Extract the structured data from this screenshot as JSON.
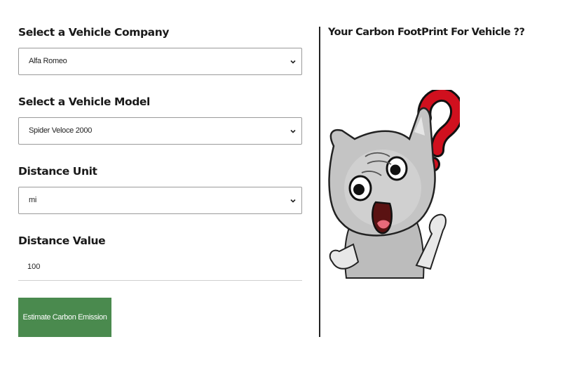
{
  "form": {
    "company": {
      "label": "Select a Vehicle Company",
      "value": "Alfa Romeo"
    },
    "model": {
      "label": "Select a Vehicle Model",
      "value": "Spider Veloce 2000"
    },
    "unit": {
      "label": "Distance Unit",
      "value": "mi"
    },
    "distance": {
      "label": "Distance Value",
      "value": "100"
    },
    "submit_label": "Estimate Carbon Emission"
  },
  "result": {
    "title": "Your Carbon FootPrint For Vehicle ??"
  },
  "colors": {
    "button_bg": "#4a8a4e",
    "question_mark": "#d0101e"
  },
  "icons": {
    "dropdown": "chevron-down-icon",
    "illustration": "confused-cat-illustration"
  }
}
